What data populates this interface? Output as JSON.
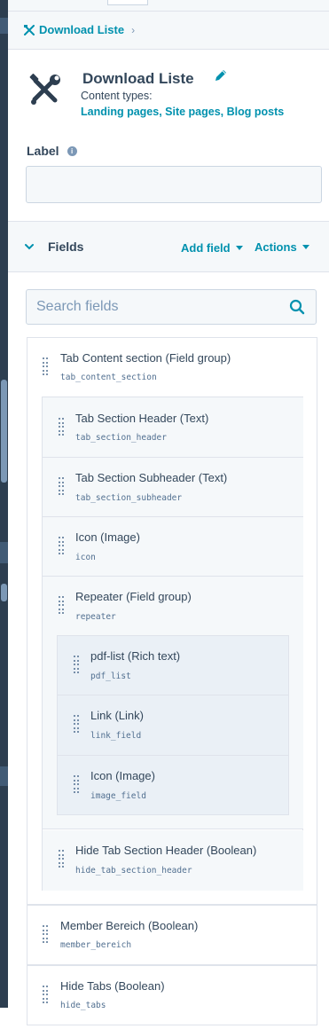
{
  "breadcrumb": {
    "label": "Download Liste"
  },
  "module": {
    "title": "Download Liste",
    "content_types_label": "Content types:",
    "content_types_value": "Landing pages, Site pages, Blog posts"
  },
  "label_section": {
    "label": "Label",
    "info_icon": "i",
    "value": ""
  },
  "fields_section": {
    "title": "Fields",
    "add_field": "Add field",
    "actions": "Actions",
    "search_placeholder": "Search fields"
  },
  "fields": [
    {
      "name": "Tab Content section (Field group)",
      "id": "tab_content_section"
    },
    {
      "name": "Tab Section Header (Text)",
      "id": "tab_section_header"
    },
    {
      "name": "Tab Section Subheader (Text)",
      "id": "tab_section_subheader"
    },
    {
      "name": "Icon (Image)",
      "id": "icon"
    },
    {
      "name": "Repeater (Field group)",
      "id": "repeater"
    },
    {
      "name": "pdf-list (Rich text)",
      "id": "pdf_list"
    },
    {
      "name": "Link (Link)",
      "id": "link_field"
    },
    {
      "name": "Icon (Image)",
      "id": "image_field"
    },
    {
      "name": "Hide Tab Section Header (Boolean)",
      "id": "hide_tab_section_header"
    },
    {
      "name": "Member Bereich (Boolean)",
      "id": "member_bereich"
    },
    {
      "name": "Hide Tabs (Boolean)",
      "id": "hide_tabs"
    }
  ],
  "icons": {
    "breadcrumb": "tools-icon",
    "module": "wrench-screwdriver-icon",
    "edit": "pencil-icon",
    "search": "search-icon",
    "collapse": "chevron-down-icon"
  },
  "colors": {
    "accent": "#0091ae",
    "text": "#33475b",
    "bg_light": "#f5f8fa",
    "border": "#dfe3eb",
    "sidebar": "#2d3e50"
  }
}
